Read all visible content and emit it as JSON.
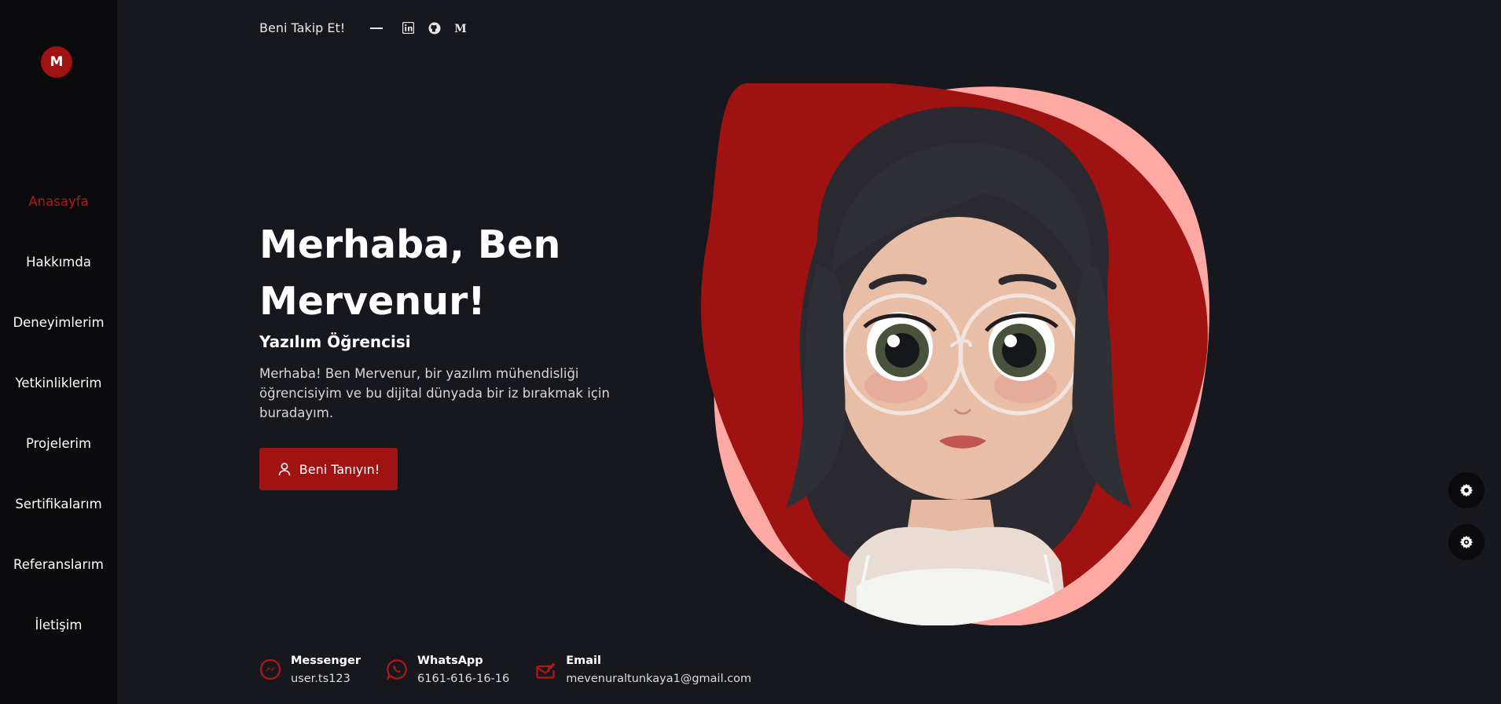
{
  "sidebar": {
    "logo": "M",
    "items": [
      {
        "label": "Anasayfa"
      },
      {
        "label": "Hakkımda"
      },
      {
        "label": "Deneyimlerim"
      },
      {
        "label": "Yetkinliklerim"
      },
      {
        "label": "Projelerim"
      },
      {
        "label": "Sertifikalarım"
      },
      {
        "label": "Referanslarım"
      },
      {
        "label": "İletişim"
      }
    ]
  },
  "follow": {
    "label": "Beni Takip Et!",
    "icons": [
      "linkedin-icon",
      "github-icon",
      "medium-icon"
    ]
  },
  "hero": {
    "title": "Merhaba, Ben Mervenur!",
    "subtitle": "Yazılım Öğrencisi",
    "description": "Merhaba! Ben Mervenur, bir yazılım mühendisliği öğrencisiyim ve bu dijital dünyada bir iz bırakmak için buradayım.",
    "button_label": "Beni Tanıyın!"
  },
  "contacts": [
    {
      "title": "Messenger",
      "value": "user.ts123",
      "icon": "messenger-icon"
    },
    {
      "title": "WhatsApp",
      "value": "6161-616-16-16",
      "icon": "whatsapp-icon"
    },
    {
      "title": "Email",
      "value": "mevenuraltunkaya1@gmail.com",
      "icon": "email-icon"
    }
  ],
  "colors": {
    "accent": "#a11313",
    "background": "#17181d",
    "sidebar": "#0b0b0e",
    "blob_pink": "#ffa9a5"
  }
}
